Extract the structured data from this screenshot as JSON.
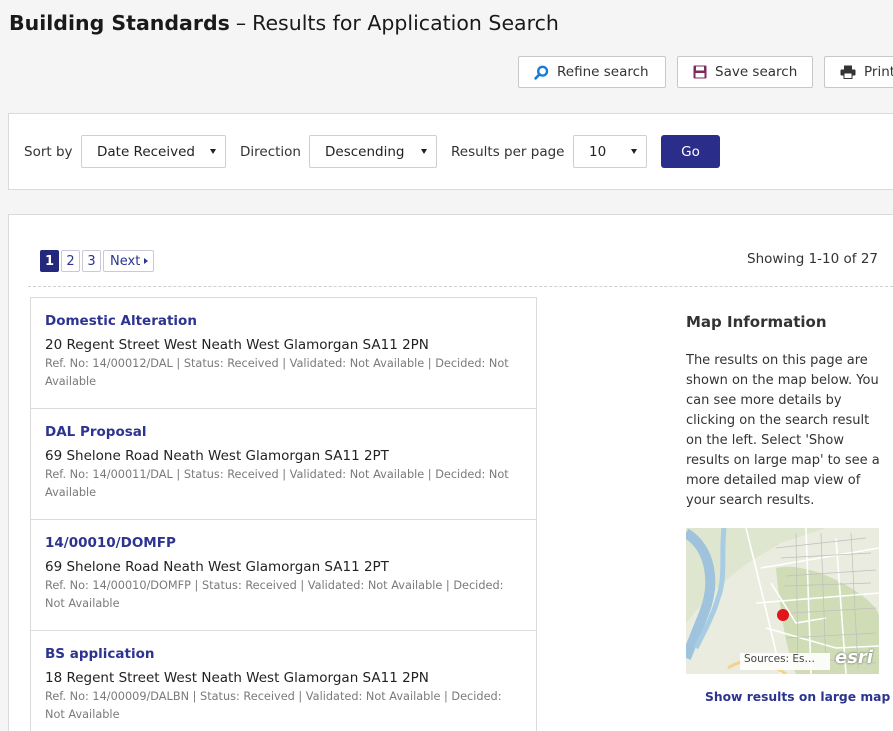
{
  "header": {
    "title_bold": "Building Standards",
    "title_sep": "–",
    "title_rest": "Results for Application Search"
  },
  "toolbar": {
    "refine_label": "Refine search",
    "save_label": "Save search",
    "print_label": "Print"
  },
  "sort_panel": {
    "sort_by_label": "Sort by",
    "sort_by_value": "Date Received",
    "direction_label": "Direction",
    "direction_value": "Descending",
    "per_page_label": "Results per page",
    "per_page_value": "10",
    "go_label": "Go"
  },
  "pagination": {
    "pages": [
      "1",
      "2",
      "3"
    ],
    "next_label": "Next",
    "current_page": 1,
    "showing_text": "Showing 1-10 of 27"
  },
  "results": [
    {
      "title": "Domestic Alteration",
      "address": "20 Regent Street West Neath West Glamorgan SA11 2PN",
      "meta": "Ref. No: 14/00012/DAL | Status: Received | Validated: Not Available | Decided: Not Available"
    },
    {
      "title": "DAL Proposal",
      "address": "69 Shelone Road Neath West Glamorgan SA11 2PT",
      "meta": "Ref. No: 14/00011/DAL | Status: Received | Validated: Not Available | Decided: Not Available"
    },
    {
      "title": "14/00010/DOMFP",
      "address": "69 Shelone Road Neath West Glamorgan SA11 2PT",
      "meta": "Ref. No: 14/00010/DOMFP | Status: Received | Validated: Not Available | Decided: Not Available"
    },
    {
      "title": "BS application",
      "address": "18 Regent Street West Neath West Glamorgan SA11 2PN",
      "meta": "Ref. No: 14/00009/DALBN | Status: Received | Validated: Not Available | Decided: Not Available"
    }
  ],
  "map_info": {
    "title": "Map Information",
    "text": "The results on this page are shown on the map below. You can see more details by clicking on the search result on the left. Select 'Show results on large map' to see a more detailed map view of your search results.",
    "attribution": "Sources: Es…",
    "esri_logo": "esri",
    "large_map_link": "Show results on large map"
  },
  "colors": {
    "accent": "#2a2d8a",
    "link": "#2c3490",
    "marker": "#e0161c"
  },
  "icons": {
    "refine": "search-icon",
    "save": "floppy-disk-icon",
    "print": "printer-icon"
  }
}
